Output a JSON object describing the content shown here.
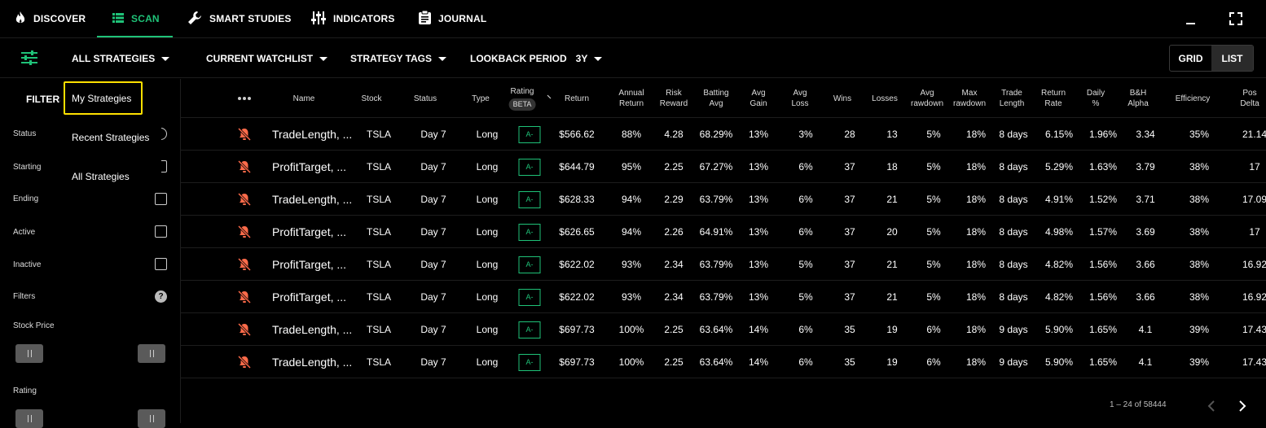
{
  "nav": {
    "items": [
      {
        "label": "DISCOVER",
        "icon": "fire-icon"
      },
      {
        "label": "SCAN",
        "icon": "list-icon",
        "active": true
      },
      {
        "label": "SMART STUDIES",
        "icon": "wrench-icon"
      },
      {
        "label": "INDICATORS",
        "icon": "sliders-icon"
      },
      {
        "label": "JOURNAL",
        "icon": "clipboard-icon"
      }
    ]
  },
  "toolbar": {
    "all_strategies": "ALL STRATEGIES",
    "current_watchlist": "CURRENT WATCHLIST",
    "strategy_tags": "STRATEGY TAGS",
    "lookback_label": "LOOKBACK PERIOD",
    "lookback_value": "3Y",
    "grid": "GRID",
    "list": "LIST"
  },
  "dropdown": {
    "items": [
      "My Strategies",
      "Recent Strategies",
      "All Strategies"
    ]
  },
  "sidebar": {
    "title": "FILTERS",
    "status": "Status",
    "starting": "Starting",
    "ending": "Ending",
    "active": "Active",
    "inactive": "Inactive",
    "filters": "Filters",
    "help": "?",
    "stock_price": "Stock Price",
    "rating": "Rating"
  },
  "table": {
    "headers": {
      "name": "Name",
      "stock": "Stock",
      "status": "Status",
      "type": "Type",
      "rating": "Rating",
      "beta": "BETA",
      "return": "Return",
      "annual_1": "Annual",
      "annual_2": "Return",
      "risk_1": "Risk",
      "risk_2": "Reward",
      "batting_1": "Batting",
      "batting_2": "Avg",
      "avggain_1": "Avg",
      "avggain_2": "Gain",
      "avgloss_1": "Avg",
      "avgloss_2": "Loss",
      "wins": "Wins",
      "losses": "Losses",
      "avgdd_1": "Avg",
      "avgdd_2": "rawdown",
      "maxdd_1": "Max",
      "maxdd_2": "rawdown",
      "tl_1": "Trade",
      "tl_2": "Length",
      "rr_1": "Return",
      "rr_2": "Rate",
      "daily_1": "Daily",
      "daily_2": "%",
      "bh_1": "B&H",
      "bh_2": "Alpha",
      "efficiency": "Efficiency",
      "pos_1": "Pos",
      "pos_2": "Delta"
    },
    "rows": [
      {
        "name": "TradeLength, ...",
        "stock": "TSLA",
        "status": "Day 7",
        "type": "Long",
        "rating": "A-",
        "ret": "$566.62",
        "annual": "88%",
        "risk": "4.28",
        "batting": "68.29%",
        "gain": "13%",
        "loss": "3%",
        "wins": "28",
        "losses": "13",
        "avgdd": "5%",
        "maxdd": "18%",
        "tl": "8 days",
        "rr": "6.15%",
        "daily": "1.96%",
        "bh": "3.34",
        "eff": "35%",
        "pos": "21.14"
      },
      {
        "name": "ProfitTarget, ...",
        "stock": "TSLA",
        "status": "Day 7",
        "type": "Long",
        "rating": "A-",
        "ret": "$644.79",
        "annual": "95%",
        "risk": "2.25",
        "batting": "67.27%",
        "gain": "13%",
        "loss": "6%",
        "wins": "37",
        "losses": "18",
        "avgdd": "5%",
        "maxdd": "18%",
        "tl": "8 days",
        "rr": "5.29%",
        "daily": "1.63%",
        "bh": "3.79",
        "eff": "38%",
        "pos": "17"
      },
      {
        "name": "TradeLength, ...",
        "stock": "TSLA",
        "status": "Day 7",
        "type": "Long",
        "rating": "A-",
        "ret": "$628.33",
        "annual": "94%",
        "risk": "2.29",
        "batting": "63.79%",
        "gain": "13%",
        "loss": "6%",
        "wins": "37",
        "losses": "21",
        "avgdd": "5%",
        "maxdd": "18%",
        "tl": "8 days",
        "rr": "4.91%",
        "daily": "1.52%",
        "bh": "3.71",
        "eff": "38%",
        "pos": "17.09"
      },
      {
        "name": "ProfitTarget, ...",
        "stock": "TSLA",
        "status": "Day 7",
        "type": "Long",
        "rating": "A-",
        "ret": "$626.65",
        "annual": "94%",
        "risk": "2.26",
        "batting": "64.91%",
        "gain": "13%",
        "loss": "6%",
        "wins": "37",
        "losses": "20",
        "avgdd": "5%",
        "maxdd": "18%",
        "tl": "8 days",
        "rr": "4.98%",
        "daily": "1.57%",
        "bh": "3.69",
        "eff": "38%",
        "pos": "17"
      },
      {
        "name": "ProfitTarget, ...",
        "stock": "TSLA",
        "status": "Day 7",
        "type": "Long",
        "rating": "A-",
        "ret": "$622.02",
        "annual": "93%",
        "risk": "2.34",
        "batting": "63.79%",
        "gain": "13%",
        "loss": "5%",
        "wins": "37",
        "losses": "21",
        "avgdd": "5%",
        "maxdd": "18%",
        "tl": "8 days",
        "rr": "4.82%",
        "daily": "1.56%",
        "bh": "3.66",
        "eff": "38%",
        "pos": "16.92"
      },
      {
        "name": "ProfitTarget, ...",
        "stock": "TSLA",
        "status": "Day 7",
        "type": "Long",
        "rating": "A-",
        "ret": "$622.02",
        "annual": "93%",
        "risk": "2.34",
        "batting": "63.79%",
        "gain": "13%",
        "loss": "5%",
        "wins": "37",
        "losses": "21",
        "avgdd": "5%",
        "maxdd": "18%",
        "tl": "8 days",
        "rr": "4.82%",
        "daily": "1.56%",
        "bh": "3.66",
        "eff": "38%",
        "pos": "16.92"
      },
      {
        "name": "TradeLength, ...",
        "stock": "TSLA",
        "status": "Day 7",
        "type": "Long",
        "rating": "A-",
        "ret": "$697.73",
        "annual": "100%",
        "risk": "2.25",
        "batting": "63.64%",
        "gain": "14%",
        "loss": "6%",
        "wins": "35",
        "losses": "19",
        "avgdd": "6%",
        "maxdd": "18%",
        "tl": "9 days",
        "rr": "5.90%",
        "daily": "1.65%",
        "bh": "4.1",
        "eff": "39%",
        "pos": "17.43"
      },
      {
        "name": "TradeLength, ...",
        "stock": "TSLA",
        "status": "Day 7",
        "type": "Long",
        "rating": "A-",
        "ret": "$697.73",
        "annual": "100%",
        "risk": "2.25",
        "batting": "63.64%",
        "gain": "14%",
        "loss": "6%",
        "wins": "35",
        "losses": "19",
        "avgdd": "6%",
        "maxdd": "18%",
        "tl": "9 days",
        "rr": "5.90%",
        "daily": "1.65%",
        "bh": "4.1",
        "eff": "39%",
        "pos": "17.43"
      }
    ]
  },
  "pagination": {
    "text": "1 – 24 of 58444"
  },
  "colors": {
    "accent": "#1fc278",
    "alert_icon": "#ff6b4a",
    "highlight": "#ffe000"
  }
}
